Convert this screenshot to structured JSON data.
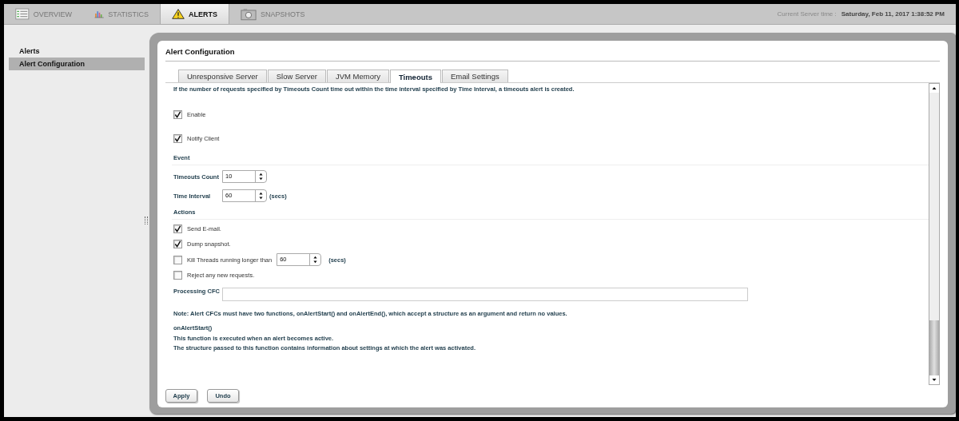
{
  "top_tabs": [
    {
      "label": "OVERVIEW",
      "selected": false
    },
    {
      "label": "STATISTICS",
      "selected": false
    },
    {
      "label": "ALERTS",
      "selected": true
    },
    {
      "label": "SNAPSHOTS",
      "selected": false
    }
  ],
  "server_time": {
    "label": "Current Server time :",
    "value": "Saturday, Feb 11, 2017  1:38:52 PM"
  },
  "sidebar": {
    "items": [
      {
        "label": "Alerts",
        "selected": false
      },
      {
        "label": "Alert Configuration",
        "selected": true
      }
    ]
  },
  "panel": {
    "title": "Alert Configuration",
    "tabs": [
      {
        "label": "Unresponsive Server",
        "selected": false
      },
      {
        "label": "Slow Server",
        "selected": false
      },
      {
        "label": "JVM Memory",
        "selected": false
      },
      {
        "label": "Timeouts",
        "selected": true
      },
      {
        "label": "Email Settings",
        "selected": false
      }
    ],
    "description": "If the number of requests specified by Timeouts Count time out within the time interval specified by Time Interval, a timeouts alert is created.",
    "options": [
      {
        "label": "Enable",
        "checked": true
      },
      {
        "label": "Notify Client",
        "checked": true
      }
    ],
    "event": {
      "heading": "Event",
      "fields": [
        {
          "label": "Timeouts Count",
          "value": "10"
        },
        {
          "label": "Time Interval",
          "value": "60",
          "unit": "(secs)"
        }
      ]
    },
    "actions": {
      "heading": "Actions",
      "items": [
        {
          "kind": "checkbox",
          "label": "Send E-mail.",
          "checked": true
        },
        {
          "kind": "checkbox",
          "label": "Dump snapshot.",
          "checked": true
        },
        {
          "kind": "spinner",
          "label": "Kill Threads running longer than",
          "checked": false,
          "value": "60",
          "unit": "(secs)"
        },
        {
          "kind": "checkbox",
          "label": "Reject any new requests.",
          "checked": false
        }
      ]
    },
    "processing_cfc": {
      "label": "Processing CFC"
    },
    "note": "Note: Alert CFCs must have two functions, onAlertStart() and onAlertEnd(), which accept a structure as an argument and return no values.",
    "function_heading": "onAlertStart()",
    "function_lines": [
      "This function is executed when an alert becomes active.",
      "The structure passed to this function contains information about settings at which the alert was activated."
    ],
    "buttons": [
      "Apply",
      "Undo"
    ]
  }
}
